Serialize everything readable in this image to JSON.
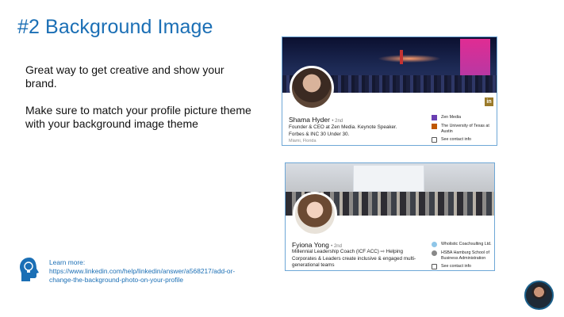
{
  "slide": {
    "title": "#2 Background Image",
    "paragraph1": "Great way to get creative and show your brand.",
    "paragraph2": "Make sure to match your profile picture theme with your background image theme"
  },
  "card1": {
    "name": "Shama Hyder",
    "degree": "• 2nd",
    "headline": "Founder & CEO at Zen Media. Keynote Speaker. Forbes & INC 30 Under 30.",
    "location": "Miami, Florida",
    "company": "Zen Media",
    "school": "The University of Texas at Austin",
    "contact": "See contact info",
    "badge": "in"
  },
  "card2": {
    "name": "Fyiona Yong",
    "degree": "• 2nd",
    "headline": "Millennial Leadership Coach (ICF ACC) ⇨ Helping Corporates & Leaders create inclusive & engaged multi-generational teams",
    "company": "Wholistic Coachsulting Ltd.",
    "school": "HSBA Hamburg School of Business Administration",
    "contact": "See contact info"
  },
  "learn_more": {
    "label": "Learn more:",
    "url": "https://www.linkedin.com/help/linkedin/answer/a568217/add-or-change-the-background-photo-on-your-profile"
  },
  "colors": {
    "title": "#1b6fb5",
    "link": "#1b6fb5",
    "card_border": "#6ea7d6"
  },
  "icons": [
    "lightbulb-head-icon",
    "linkedin-icon",
    "company-icon",
    "school-icon",
    "contact-info-icon"
  ]
}
